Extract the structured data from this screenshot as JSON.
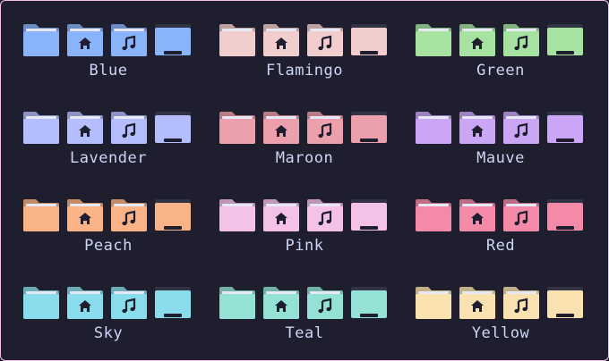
{
  "frame_border_color": "#f5c2e7",
  "background_color": "#1e1e2e",
  "text_color": "#cdd6f4",
  "glyph_color": "#1e1e2e",
  "icon_kinds": [
    "plain-folder-icon",
    "home-folder-icon",
    "music-folder-icon",
    "desktop-folder-icon"
  ],
  "groups": [
    {
      "label": "Blue",
      "color": "#89b4fa"
    },
    {
      "label": "Flamingo",
      "color": "#f2cdcd"
    },
    {
      "label": "Green",
      "color": "#a6e3a1"
    },
    {
      "label": "Lavender",
      "color": "#b4befe"
    },
    {
      "label": "Maroon",
      "color": "#eba0ac"
    },
    {
      "label": "Mauve",
      "color": "#cba6f7"
    },
    {
      "label": "Peach",
      "color": "#fab387"
    },
    {
      "label": "Pink",
      "color": "#f5c2e7"
    },
    {
      "label": "Red",
      "color": "#f38ba8"
    },
    {
      "label": "Sky",
      "color": "#89dceb"
    },
    {
      "label": "Teal",
      "color": "#94e2d5"
    },
    {
      "label": "Yellow",
      "color": "#f9e2af"
    }
  ]
}
